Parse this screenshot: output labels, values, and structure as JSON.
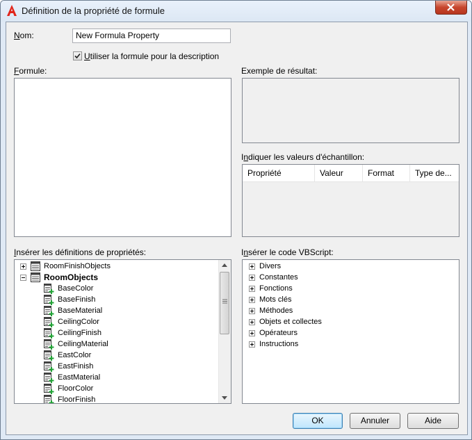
{
  "window": {
    "title": "Définition de la propriété de formule"
  },
  "nom": {
    "label": "Nom:",
    "value": "New Formula Property"
  },
  "use_formula": {
    "label": "Utiliser la formule pour la description",
    "checked": true
  },
  "formule": {
    "label": "Formule:"
  },
  "exemple": {
    "label": "Exemple de résultat:"
  },
  "sample_values": {
    "label": "Indiquer les valeurs d'échantillon:",
    "columns": [
      "Propriété",
      "Valeur",
      "Format",
      "Type de..."
    ]
  },
  "prop_defs": {
    "label": "Insérer les définitions de propriétés:",
    "groups": [
      {
        "label": "RoomFinishObjects",
        "expanded": false
      },
      {
        "label": "RoomObjects",
        "expanded": true
      }
    ],
    "items": [
      "BaseColor",
      "BaseFinish",
      "BaseMaterial",
      "CeilingColor",
      "CeilingFinish",
      "CeilingMaterial",
      "EastColor",
      "EastFinish",
      "EastMaterial",
      "FloorColor",
      "FloorFinish"
    ]
  },
  "vbscript": {
    "label": "Insérer le code VBScript:",
    "items": [
      "Divers",
      "Constantes",
      "Fonctions",
      "Mots clés",
      "Méthodes",
      "Objets et collectes",
      "Opérateurs",
      "Instructions"
    ]
  },
  "buttons": {
    "ok": "OK",
    "cancel": "Annuler",
    "help": "Aide"
  },
  "colors": {
    "accent_red": "#c7462d",
    "plus_green": "#21a336"
  }
}
